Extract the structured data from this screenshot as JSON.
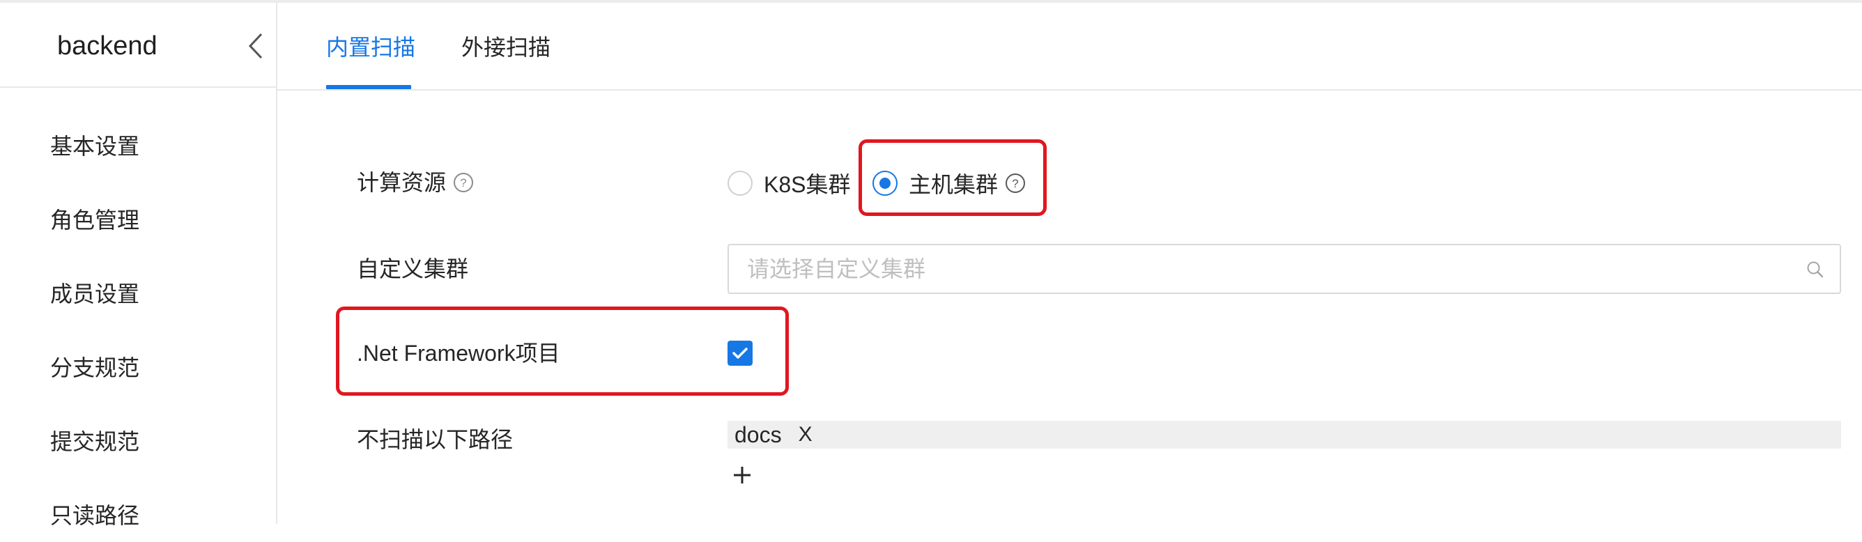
{
  "sidebar": {
    "app_title": "backend",
    "items": [
      {
        "label": "基本设置"
      },
      {
        "label": "角色管理"
      },
      {
        "label": "成员设置"
      },
      {
        "label": "分支规范"
      },
      {
        "label": "提交规范"
      },
      {
        "label": "只读路径"
      }
    ]
  },
  "tabs": [
    {
      "label": "内置扫描",
      "active": true
    },
    {
      "label": "外接扫描",
      "active": false
    }
  ],
  "form": {
    "compute_resource": {
      "label": "计算资源",
      "options": [
        {
          "label": "K8S集群",
          "checked": false
        },
        {
          "label": "主机集群",
          "checked": true
        }
      ]
    },
    "custom_cluster": {
      "label": "自定义集群",
      "placeholder": "请选择自定义集群"
    },
    "net_framework": {
      "label": ".Net Framework项目",
      "checked": true
    },
    "exclude_paths": {
      "label": "不扫描以下路径",
      "tags": [
        "docs"
      ],
      "tag_close": "X"
    }
  },
  "colors": {
    "accent": "#1677e5",
    "highlight": "#e0171f"
  }
}
